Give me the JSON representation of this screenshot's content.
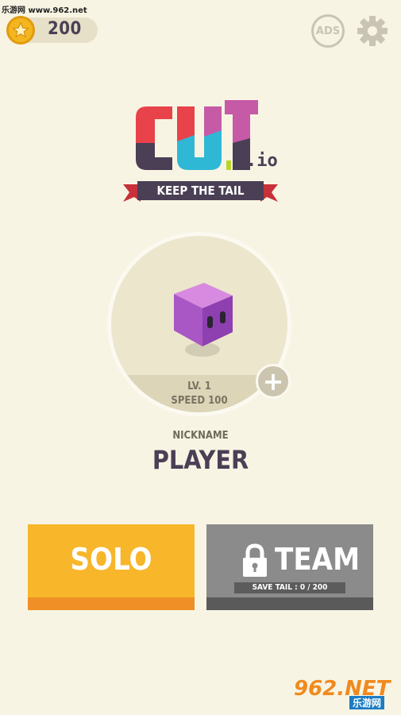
{
  "watermark": {
    "top_text": "乐游网 www.962.net",
    "bottom_big": "962.NET",
    "bottom_small": "乐游网"
  },
  "header": {
    "coins": "200",
    "ads_label": "ADS",
    "icons": {
      "coin": "star-coin-icon",
      "ads": "no-ads-icon",
      "settings": "gear-icon"
    }
  },
  "logo": {
    "letters": [
      "C",
      "U",
      "T"
    ],
    "suffix": ".io",
    "tagline": "KEEP THE TAIL",
    "colors": {
      "c": "#e8434a",
      "u": "#2fb8d6",
      "t": "#c65aa6",
      "dark": "#4a3f55",
      "ribbon": "#4a3f55",
      "ribbon_edge": "#c8303a"
    }
  },
  "character": {
    "level": "LV. 1",
    "speed": "SPEED 100",
    "plus_icon": "plus-icon",
    "cube_color": "#a857c4"
  },
  "nickname": {
    "label": "NICKNAME",
    "value": "PLAYER"
  },
  "buttons": {
    "solo": {
      "label": "SOLO",
      "color": "#f8b62a"
    },
    "team": {
      "label": "TEAM",
      "save_tail": "SAVE TAIL : 0 / 200",
      "locked": true,
      "color": "#8b8b8b"
    }
  }
}
